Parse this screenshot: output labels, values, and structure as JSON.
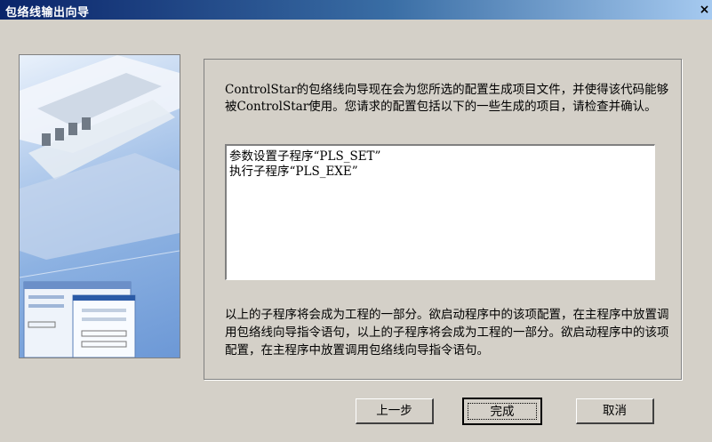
{
  "window": {
    "title": "包络线输出向导",
    "close_glyph": "×"
  },
  "main": {
    "description": "ControlStar的包络线向导现在会为您所选的配置生成项目文件，并使得该代码能够被ControlStar使用。您请求的配置包括以下的一些生成的项目，请检查并确认。",
    "items": [
      "参数设置子程序“PLS_SET”",
      "执行子程序“PLS_EXE”"
    ],
    "note": "以上的子程序将会成为工程的一部分。欲启动程序中的该项配置，在主程序中放置调用包络线向导指令语句，以上的子程序将会成为工程的一部分。欲启动程序中的该项配置，在主程序中放置调用包络线向导指令语句。"
  },
  "buttons": {
    "back": "上一步",
    "finish": "完成",
    "cancel": "取消"
  },
  "colors": {
    "dialog_bg": "#d4d0c8",
    "title_start": "#0a246a",
    "title_end": "#a6caf0"
  }
}
